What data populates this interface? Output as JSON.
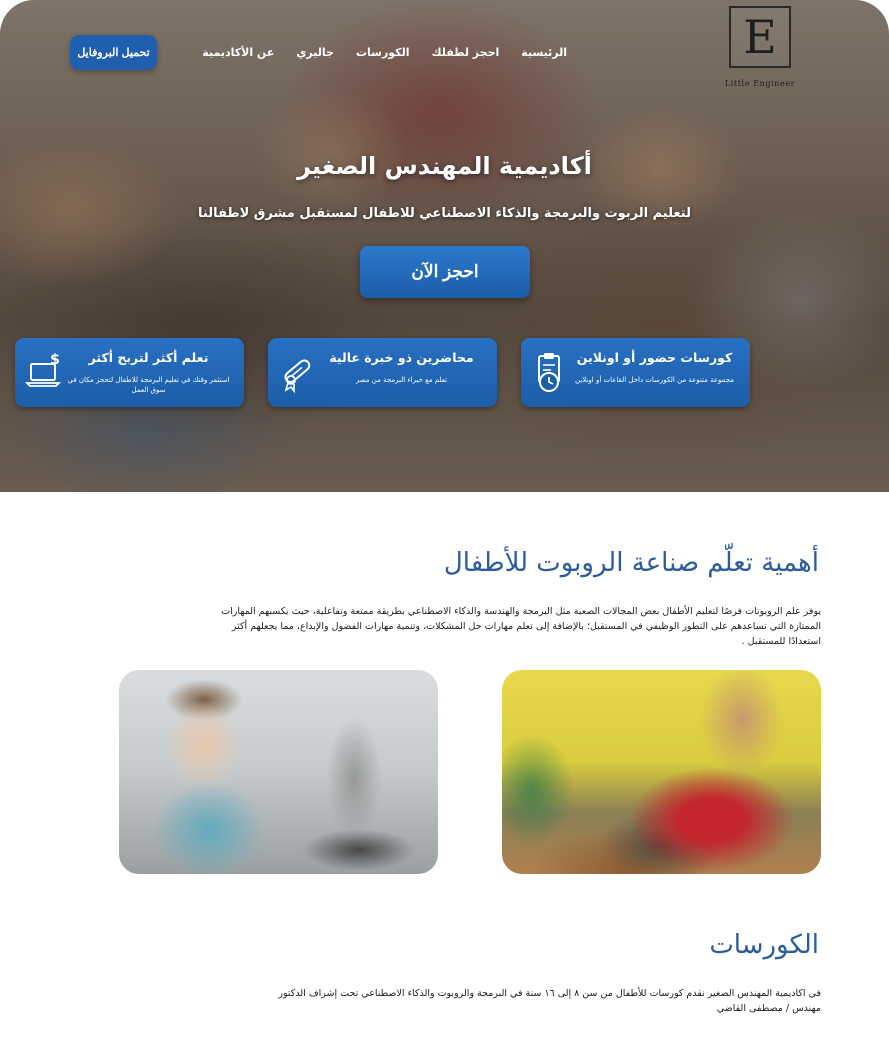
{
  "logo": {
    "letter": "E",
    "text": "Little Engineer"
  },
  "nav": {
    "items": [
      {
        "label": "الرئيسية"
      },
      {
        "label": "احجز لطفلك"
      },
      {
        "label": "الكورسات"
      },
      {
        "label": "جاليري"
      },
      {
        "label": "عن الأكاديمية"
      }
    ]
  },
  "header": {
    "profile_button": "تحميل البروفايل"
  },
  "hero": {
    "title": "أكاديمية المهندس الصغير",
    "subtitle": "لتعليم الربوت والبرمجة والذكاء الاصطناعي للاطفال لمستقبل مشرق لاطفالنا",
    "cta": "احجز الآن"
  },
  "features": [
    {
      "title": "كورسات حضور أو اونلاين",
      "desc": "مجموعة متنوعة من الكورسات داخل القاعات أو اونلاين",
      "icon": "clipboard-clock-icon"
    },
    {
      "title": "محاضرين ذو خبرة عالية",
      "desc": "تعلم مع خبراء البرمجة من مصر",
      "icon": "diploma-icon"
    },
    {
      "title": "تعلم أكثر لتربح أكثر",
      "desc": "استثمر وقتك في تعليم البرمجة للاطفال لتحجز مكان في سوق العمل",
      "icon": "laptop-dollar-icon"
    }
  ],
  "importance": {
    "title": "أهمية تعلّم صناعة الروبوت للأطفال",
    "text": "يوفر علم الروبوتات فرصًا لتعليم الأطفال بعض المجالات الصعبة مثل البرمجة والهندسة والذكاء الاصطناعي بطريقة ممتعة وتفاعلية، حيث يكسبهم المهارات الممتازة التي تساعدهم على التطور الوظيفي في المستقبل؛ بالإضافة إلى تعلم مهارات حل المشكلات، وتنمية مهارات الفضول والإبداع، مما يجعلهم أكثر استعدادًا للمستقبل ."
  },
  "courses": {
    "title": "الكورسات",
    "text": "في اكاديمية المهندس الصغير نقدم كورسات للأطفال من سن ٨ إلى ١٦ سنة في البرمجة والروبوت والذكاء الاصطناعي تحت إشراف الدكتور مهندس / مصطفى القاضي"
  },
  "colors": {
    "primary_blue": "#1f5fae",
    "heading_blue": "#2d5c9c"
  }
}
